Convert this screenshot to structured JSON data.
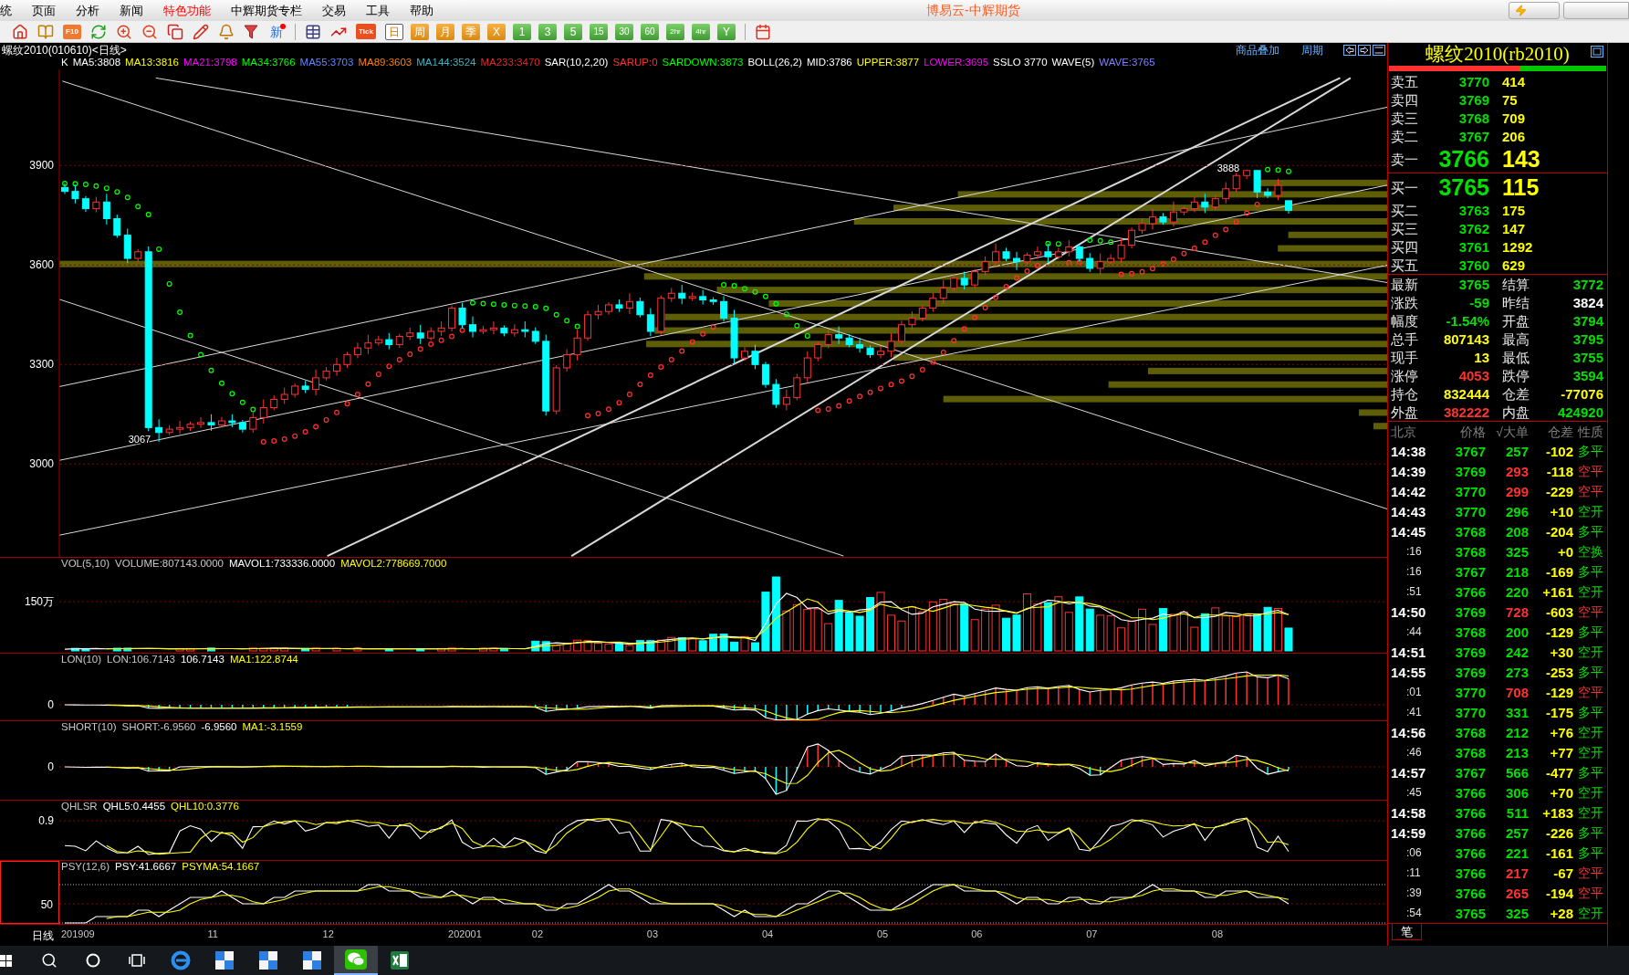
{
  "menu": [
    {
      "label": "统",
      "highlighted": false
    },
    {
      "label": "页面",
      "highlighted": false
    },
    {
      "label": "分析",
      "highlighted": false
    },
    {
      "label": "新闻",
      "highlighted": false
    },
    {
      "label": "特色功能",
      "highlighted": true
    },
    {
      "label": "中辉期货专栏",
      "highlighted": false
    },
    {
      "label": "交易",
      "highlighted": false
    },
    {
      "label": "工具",
      "highlighted": false
    },
    {
      "label": "帮助",
      "highlighted": false
    }
  ],
  "window": {
    "title": "博易云-中辉期货"
  },
  "toolbar": {
    "f10": "F10",
    "news": "新",
    "tick": "Tick",
    "periods": [
      {
        "label": "日",
        "kind": "calendar",
        "selected": true
      },
      {
        "label": "周",
        "kind": "calendar",
        "selected": false
      },
      {
        "label": "月",
        "kind": "calendar",
        "selected": false
      },
      {
        "label": "季",
        "kind": "calendar",
        "selected": false
      },
      {
        "label": "X",
        "kind": "calendar",
        "selected": false
      },
      {
        "label": "1",
        "kind": "intraday",
        "selected": false
      },
      {
        "label": "3",
        "kind": "intraday",
        "selected": false
      },
      {
        "label": "5",
        "kind": "intraday",
        "selected": false
      },
      {
        "label": "15",
        "kind": "intraday",
        "selected": false
      },
      {
        "label": "30",
        "kind": "intraday",
        "selected": false
      },
      {
        "label": "60",
        "kind": "intraday",
        "selected": false
      },
      {
        "label": "2hr",
        "kind": "intraday",
        "selected": false
      },
      {
        "label": "4hr",
        "kind": "intraday",
        "selected": false
      },
      {
        "label": "Y",
        "kind": "intraday",
        "selected": false
      }
    ]
  },
  "chart_header": {
    "symbol": "螺纹2010(010610)<日线>",
    "links": [
      "商品叠加",
      "周期"
    ]
  },
  "main_chart": {
    "legend": [
      {
        "text": "K",
        "kind": "label",
        "color": "#ffffff"
      },
      {
        "text": "MA5:3808",
        "kind": "label",
        "color": "#ffffff"
      },
      {
        "text": "MA13:3816",
        "kind": "label",
        "color": "#ffff00"
      },
      {
        "text": "MA21:3798",
        "kind": "label",
        "color": "#ff00ff"
      },
      {
        "text": "MA34:3766",
        "kind": "label",
        "color": "#00ff00"
      },
      {
        "text": "MA55:3703",
        "kind": "label",
        "color": "#5f87ff"
      },
      {
        "text": "MA89:3603",
        "kind": "label",
        "color": "#ff8000"
      },
      {
        "text": "MA144:3524",
        "kind": "label",
        "color": "#40b0c0"
      },
      {
        "text": "MA233:3470",
        "kind": "label",
        "color": "#e02828"
      },
      {
        "text": "SAR(10,2,20)",
        "kind": "label",
        "color": "#ffffff"
      },
      {
        "text": "SARUP:0",
        "kind": "sarup",
        "color": "#ff3030"
      },
      {
        "text": "SARDOWN:3873",
        "kind": "sardown",
        "color": "#00ff00"
      },
      {
        "text": "BOLL(26,2)",
        "kind": "label",
        "color": "#ffffff"
      },
      {
        "text": "MID:3786",
        "kind": "label",
        "color": "#ffffff"
      },
      {
        "text": "UPPER:3877",
        "kind": "label",
        "color": "#ffff00"
      },
      {
        "text": "LOWER:3695",
        "kind": "label",
        "color": "#ff00ff"
      },
      {
        "text": "SSLO 3770",
        "kind": "label",
        "color": "#ffffff"
      },
      {
        "text": "WAVE(5)",
        "kind": "label",
        "color": "#ffffff"
      },
      {
        "text": "WAVE:3765",
        "kind": "label",
        "color": "#8080ff"
      }
    ],
    "chart_data": {
      "type": "candlestick",
      "ohlc": [
        [
          3834,
          3846,
          3814,
          3822
        ],
        [
          3822,
          3842,
          3786,
          3800
        ],
        [
          3800,
          3808,
          3760,
          3770
        ],
        [
          3770,
          3806,
          3759,
          3790
        ],
        [
          3790,
          3815,
          3722,
          3740
        ],
        [
          3740,
          3752,
          3682,
          3690
        ],
        [
          3690,
          3710,
          3606,
          3620
        ],
        [
          3620,
          3648,
          3610,
          3640
        ],
        [
          3640,
          3656,
          3099,
          3110
        ],
        [
          3110,
          3135,
          3067,
          3095
        ],
        [
          3095,
          3117,
          3087,
          3105
        ],
        [
          3105,
          3130,
          3091,
          3110
        ],
        [
          3110,
          3128,
          3100,
          3120
        ],
        [
          3120,
          3141,
          3109,
          3125
        ],
        [
          3125,
          3150,
          3100,
          3118
        ],
        [
          3118,
          3142,
          3110,
          3130
        ],
        [
          3130,
          3150,
          3111,
          3125
        ],
        [
          3125,
          3133,
          3095,
          3105
        ],
        [
          3105,
          3156,
          3094,
          3140
        ],
        [
          3140,
          3195,
          3122,
          3170
        ],
        [
          3170,
          3207,
          3162,
          3195
        ],
        [
          3195,
          3230,
          3181,
          3210
        ],
        [
          3210,
          3243,
          3200,
          3235
        ],
        [
          3235,
          3251,
          3214,
          3225
        ],
        [
          3225,
          3285,
          3207,
          3260
        ],
        [
          3260,
          3292,
          3252,
          3280
        ],
        [
          3280,
          3320,
          3266,
          3300
        ],
        [
          3300,
          3338,
          3290,
          3330
        ],
        [
          3330,
          3366,
          3319,
          3350
        ],
        [
          3350,
          3390,
          3332,
          3365
        ],
        [
          3365,
          3387,
          3357,
          3375
        ],
        [
          3375,
          3395,
          3346,
          3360
        ],
        [
          3360,
          3393,
          3350,
          3385
        ],
        [
          3385,
          3411,
          3374,
          3395
        ],
        [
          3395,
          3420,
          3362,
          3380
        ],
        [
          3380,
          3412,
          3372,
          3400
        ],
        [
          3400,
          3430,
          3386,
          3410
        ],
        [
          3410,
          3478,
          3400,
          3470
        ],
        [
          3470,
          3486,
          3409,
          3420
        ],
        [
          3420,
          3445,
          3382,
          3400
        ],
        [
          3400,
          3417,
          3392,
          3405
        ],
        [
          3405,
          3430,
          3391,
          3410
        ],
        [
          3410,
          3418,
          3385,
          3395
        ],
        [
          3395,
          3421,
          3384,
          3405
        ],
        [
          3405,
          3430,
          3382,
          3400
        ],
        [
          3400,
          3412,
          3362,
          3370
        ],
        [
          3370,
          3390,
          3146,
          3160
        ],
        [
          3160,
          3298,
          3150,
          3290
        ],
        [
          3290,
          3346,
          3279,
          3330
        ],
        [
          3330,
          3405,
          3312,
          3380
        ],
        [
          3380,
          3462,
          3372,
          3450
        ],
        [
          3450,
          3480,
          3436,
          3460
        ],
        [
          3460,
          3488,
          3450,
          3480
        ],
        [
          3480,
          3496,
          3459,
          3470
        ],
        [
          3470,
          3515,
          3452,
          3490
        ],
        [
          3490,
          3502,
          3442,
          3450
        ],
        [
          3450,
          3470,
          3386,
          3400
        ],
        [
          3400,
          3508,
          3390,
          3500
        ],
        [
          3500,
          3531,
          3489,
          3515
        ],
        [
          3515,
          3540,
          3482,
          3500
        ],
        [
          3500,
          3517,
          3492,
          3505
        ],
        [
          3505,
          3525,
          3481,
          3495
        ],
        [
          3495,
          3503,
          3480,
          3490
        ],
        [
          3490,
          3506,
          3429,
          3440
        ],
        [
          3440,
          3465,
          3302,
          3320
        ],
        [
          3320,
          3352,
          3312,
          3340
        ],
        [
          3340,
          3360,
          3286,
          3300
        ],
        [
          3300,
          3308,
          3230,
          3240
        ],
        [
          3240,
          3256,
          3169,
          3180
        ],
        [
          3180,
          3225,
          3162,
          3200
        ],
        [
          3200,
          3272,
          3192,
          3260
        ],
        [
          3260,
          3340,
          3246,
          3320
        ],
        [
          3320,
          3368,
          3310,
          3360
        ],
        [
          3360,
          3406,
          3349,
          3390
        ],
        [
          3390,
          3415,
          3362,
          3380
        ],
        [
          3380,
          3392,
          3352,
          3360
        ],
        [
          3360,
          3380,
          3336,
          3350
        ],
        [
          3350,
          3358,
          3320,
          3330
        ],
        [
          3330,
          3356,
          3319,
          3340
        ],
        [
          3340,
          3395,
          3322,
          3370
        ],
        [
          3370,
          3432,
          3362,
          3420
        ],
        [
          3420,
          3460,
          3406,
          3440
        ],
        [
          3440,
          3478,
          3430,
          3470
        ],
        [
          3470,
          3516,
          3459,
          3500
        ],
        [
          3500,
          3555,
          3482,
          3530
        ],
        [
          3530,
          3572,
          3522,
          3560
        ],
        [
          3560,
          3580,
          3526,
          3540
        ],
        [
          3540,
          3588,
          3530,
          3580
        ],
        [
          3580,
          3626,
          3569,
          3610
        ],
        [
          3610,
          3665,
          3592,
          3640
        ],
        [
          3640,
          3652,
          3612,
          3620
        ],
        [
          3620,
          3640,
          3585,
          3610
        ],
        [
          3610,
          3638,
          3600,
          3630
        ],
        [
          3630,
          3656,
          3619,
          3640
        ],
        [
          3640,
          3665,
          3607,
          3625
        ],
        [
          3625,
          3652,
          3617,
          3640
        ],
        [
          3640,
          3675,
          3626,
          3655
        ],
        [
          3655,
          3663,
          3610,
          3620
        ],
        [
          3620,
          3636,
          3579,
          3590
        ],
        [
          3590,
          3635,
          3572,
          3610
        ],
        [
          3610,
          3632,
          3602,
          3620
        ],
        [
          3620,
          3680,
          3606,
          3660
        ],
        [
          3660,
          3713,
          3650,
          3705
        ],
        [
          3705,
          3741,
          3694,
          3725
        ],
        [
          3725,
          3770,
          3707,
          3745
        ],
        [
          3745,
          3757,
          3722,
          3730
        ],
        [
          3730,
          3792,
          3716,
          3760
        ],
        [
          3760,
          3778,
          3750,
          3770
        ],
        [
          3770,
          3806,
          3759,
          3790
        ],
        [
          3790,
          3815,
          3757,
          3775
        ],
        [
          3775,
          3812,
          3767,
          3800
        ],
        [
          3800,
          3850,
          3786,
          3830
        ],
        [
          3830,
          3878,
          3820,
          3870
        ],
        [
          3870,
          3888,
          3859,
          3885
        ],
        [
          3885,
          3885,
          3802,
          3820
        ],
        [
          3820,
          3832,
          3802,
          3810
        ],
        [
          3810,
          3860,
          3796,
          3840
        ],
        [
          3794,
          3795,
          3755,
          3765
        ]
      ],
      "ylim": [
        2720,
        4190
      ],
      "yticks": [
        {
          "value": 3000,
          "label": "3000"
        },
        {
          "value": 3300,
          "label": "3300"
        },
        {
          "value": 3600,
          "label": "3600"
        },
        {
          "value": 3900,
          "label": "3900"
        }
      ],
      "grid": true,
      "annotations": [
        "3888",
        "3067"
      ]
    }
  },
  "panes": [
    {
      "kind": "volume",
      "axis_label": "150万",
      "selected": false,
      "legend": [
        {
          "text": "VOL(5,10)",
          "kind": "label",
          "color": "#c8c8c8"
        },
        {
          "text": "VOLUME:807143.0000",
          "kind": "label",
          "color": "#c8c8c8"
        },
        {
          "text": "MAVOL1:733336.0000",
          "kind": "main",
          "color": "#ffffff"
        },
        {
          "text": "MAVOL2:778669.7000",
          "kind": "signal",
          "color": "#ffff00"
        }
      ]
    },
    {
      "kind": "lon",
      "axis_label": "0",
      "selected": false,
      "legend": [
        {
          "text": "LON(10)",
          "kind": "label",
          "color": "#c8c8c8"
        },
        {
          "text": "LON:106.7143",
          "kind": "label",
          "color": "#c8c8c8"
        },
        {
          "text": "106.7143",
          "kind": "main",
          "color": "#ffffff"
        },
        {
          "text": "MA1:122.8744",
          "kind": "signal",
          "color": "#ffff00"
        }
      ]
    },
    {
      "kind": "short",
      "axis_label": "0",
      "selected": false,
      "legend": [
        {
          "text": "SHORT(10)",
          "kind": "label",
          "color": "#c8c8c8"
        },
        {
          "text": "SHORT:-6.9560",
          "kind": "label",
          "color": "#c8c8c8"
        },
        {
          "text": "-6.9560",
          "kind": "main",
          "color": "#ffffff"
        },
        {
          "text": "MA1:-3.1559",
          "kind": "signal",
          "color": "#ffff00"
        }
      ]
    },
    {
      "kind": "qhlsr",
      "axis_label": "0.9",
      "selected": false,
      "legend": [
        {
          "text": "QHLSR",
          "kind": "label",
          "color": "#c8c8c8"
        },
        {
          "text": "QHL5:0.4455",
          "kind": "main",
          "color": "#ffffff"
        },
        {
          "text": "QHL10:0.3776",
          "kind": "signal",
          "color": "#ffff00"
        }
      ]
    },
    {
      "kind": "psy",
      "axis_label": "50",
      "selected": true,
      "legend": [
        {
          "text": "PSY(12,6)",
          "kind": "label",
          "color": "#c8c8c8"
        },
        {
          "text": "PSY:41.6667",
          "kind": "main",
          "color": "#ffffff"
        },
        {
          "text": "PSYMA:54.1667",
          "kind": "signal",
          "color": "#ffff00"
        }
      ]
    }
  ],
  "x_axis": {
    "label": "日线",
    "ticks": [
      "201909",
      "11",
      "12",
      "202001",
      "02",
      "03",
      "04",
      "05",
      "06",
      "07",
      "08"
    ]
  },
  "quote": {
    "title": "螺纹2010(rb2010)",
    "ratio": {
      "level": 0.6
    },
    "asks": [
      {
        "label": "卖五",
        "price": "3770",
        "volume": "414"
      },
      {
        "label": "卖四",
        "price": "3769",
        "volume": "75"
      },
      {
        "label": "卖三",
        "price": "3768",
        "volume": "709"
      },
      {
        "label": "卖二",
        "price": "3767",
        "volume": "206"
      },
      {
        "label": "卖一",
        "price": "3766",
        "volume": "143"
      }
    ],
    "bids": [
      {
        "label": "买一",
        "price": "3765",
        "volume": "115"
      },
      {
        "label": "买二",
        "price": "3763",
        "volume": "175"
      },
      {
        "label": "买三",
        "price": "3762",
        "volume": "147"
      },
      {
        "label": "买四",
        "price": "3761",
        "volume": "1292"
      },
      {
        "label": "买五",
        "price": "3760",
        "volume": "629"
      }
    ],
    "stats": [
      {
        "label": "最新",
        "value": "3765",
        "color": "#00e000"
      },
      {
        "label": "结算",
        "value": "3772",
        "color": "#00e000"
      },
      {
        "label": "涨跌",
        "value": "-59",
        "color": "#00e000"
      },
      {
        "label": "昨结",
        "value": "3824",
        "color": "#ffffff"
      },
      {
        "label": "幅度",
        "value": "-1.54%",
        "color": "#00e000"
      },
      {
        "label": "开盘",
        "value": "3794",
        "color": "#00e000"
      },
      {
        "label": "总手",
        "value": "807143",
        "color": "#ffff00"
      },
      {
        "label": "最高",
        "value": "3795",
        "color": "#00e000"
      },
      {
        "label": "现手",
        "value": "13",
        "color": "#ffff00"
      },
      {
        "label": "最低",
        "value": "3755",
        "color": "#00e000"
      },
      {
        "label": "涨停",
        "value": "4053",
        "color": "#ff3232"
      },
      {
        "label": "跌停",
        "value": "3594",
        "color": "#00e000"
      },
      {
        "label": "持仓",
        "value": "832444",
        "color": "#ffff00"
      },
      {
        "label": "仓差",
        "value": "-77076",
        "color": "#ffff00"
      },
      {
        "label": "外盘",
        "value": "382222",
        "color": "#ff3232"
      },
      {
        "label": "内盘",
        "value": "424920",
        "color": "#00e000"
      }
    ],
    "ticks": {
      "columns": [
        "北京",
        "价格",
        "√大单",
        "仓差",
        "性质"
      ],
      "rows": [
        {
          "time": "14:38",
          "kind": "minute",
          "price": "3767",
          "volume": "257",
          "change": "-102",
          "nature": "多平",
          "color": "#00e000"
        },
        {
          "time": "14:39",
          "kind": "minute",
          "price": "3769",
          "volume": "293",
          "change": "-118",
          "nature": "空平",
          "color": "#ff3232"
        },
        {
          "time": "14:42",
          "kind": "minute",
          "price": "3770",
          "volume": "299",
          "change": "-229",
          "nature": "空平",
          "color": "#ff3232"
        },
        {
          "time": "14:43",
          "kind": "minute",
          "price": "3770",
          "volume": "296",
          "change": "+10",
          "nature": "空开",
          "color": "#00e000"
        },
        {
          "time": "14:45",
          "kind": "minute",
          "price": "3768",
          "volume": "208",
          "change": "-204",
          "nature": "多平",
          "color": "#00e000"
        },
        {
          "time": ":16",
          "kind": "second",
          "price": "3768",
          "volume": "325",
          "change": "+0",
          "nature": "空换",
          "color": "#00e000"
        },
        {
          "time": ":16",
          "kind": "second",
          "price": "3767",
          "volume": "218",
          "change": "-169",
          "nature": "多平",
          "color": "#00e000"
        },
        {
          "time": ":51",
          "kind": "second",
          "price": "3766",
          "volume": "220",
          "change": "+161",
          "nature": "空开",
          "color": "#00e000"
        },
        {
          "time": "14:50",
          "kind": "minute",
          "price": "3769",
          "volume": "728",
          "change": "-603",
          "nature": "空平",
          "color": "#ff3232"
        },
        {
          "time": ":44",
          "kind": "second",
          "price": "3768",
          "volume": "200",
          "change": "-129",
          "nature": "多平",
          "color": "#00e000"
        },
        {
          "time": "14:51",
          "kind": "minute",
          "price": "3769",
          "volume": "242",
          "change": "+30",
          "nature": "空开",
          "color": "#00e000"
        },
        {
          "time": "14:55",
          "kind": "minute",
          "price": "3769",
          "volume": "273",
          "change": "-253",
          "nature": "多平",
          "color": "#00e000"
        },
        {
          "time": ":01",
          "kind": "second",
          "price": "3770",
          "volume": "708",
          "change": "-129",
          "nature": "空平",
          "color": "#ff3232"
        },
        {
          "time": ":41",
          "kind": "second",
          "price": "3770",
          "volume": "331",
          "change": "-175",
          "nature": "多平",
          "color": "#00e000"
        },
        {
          "time": "14:56",
          "kind": "minute",
          "price": "3768",
          "volume": "212",
          "change": "+76",
          "nature": "空开",
          "color": "#00e000"
        },
        {
          "time": ":46",
          "kind": "second",
          "price": "3768",
          "volume": "213",
          "change": "+77",
          "nature": "空开",
          "color": "#00e000"
        },
        {
          "time": "14:57",
          "kind": "minute",
          "price": "3767",
          "volume": "566",
          "change": "-477",
          "nature": "多平",
          "color": "#00e000"
        },
        {
          "time": ":45",
          "kind": "second",
          "price": "3766",
          "volume": "306",
          "change": "+70",
          "nature": "空开",
          "color": "#00e000"
        },
        {
          "time": "14:58",
          "kind": "minute",
          "price": "3766",
          "volume": "511",
          "change": "+183",
          "nature": "空开",
          "color": "#00e000"
        },
        {
          "time": "14:59",
          "kind": "minute",
          "price": "3766",
          "volume": "257",
          "change": "-226",
          "nature": "多平",
          "color": "#00e000"
        },
        {
          "time": ":06",
          "kind": "second",
          "price": "3766",
          "volume": "221",
          "change": "-161",
          "nature": "多平",
          "color": "#00e000"
        },
        {
          "time": ":11",
          "kind": "second",
          "price": "3766",
          "volume": "217",
          "change": "-67",
          "nature": "空平",
          "color": "#ff3232"
        },
        {
          "time": ":39",
          "kind": "second",
          "price": "3766",
          "volume": "265",
          "change": "-194",
          "nature": "空平",
          "color": "#ff3232"
        },
        {
          "time": ":54",
          "kind": "second",
          "price": "3765",
          "volume": "325",
          "change": "+28",
          "nature": "空开",
          "color": "#00e000"
        }
      ]
    },
    "tab": "笔"
  },
  "taskbar": {
    "apps": [
      {
        "kind": "browser",
        "selected": false
      },
      {
        "kind": "app",
        "selected": false
      },
      {
        "kind": "app",
        "selected": false
      },
      {
        "kind": "app",
        "selected": false
      },
      {
        "kind": "chat",
        "selected": true
      },
      {
        "kind": "sheet",
        "selected": false
      }
    ]
  }
}
